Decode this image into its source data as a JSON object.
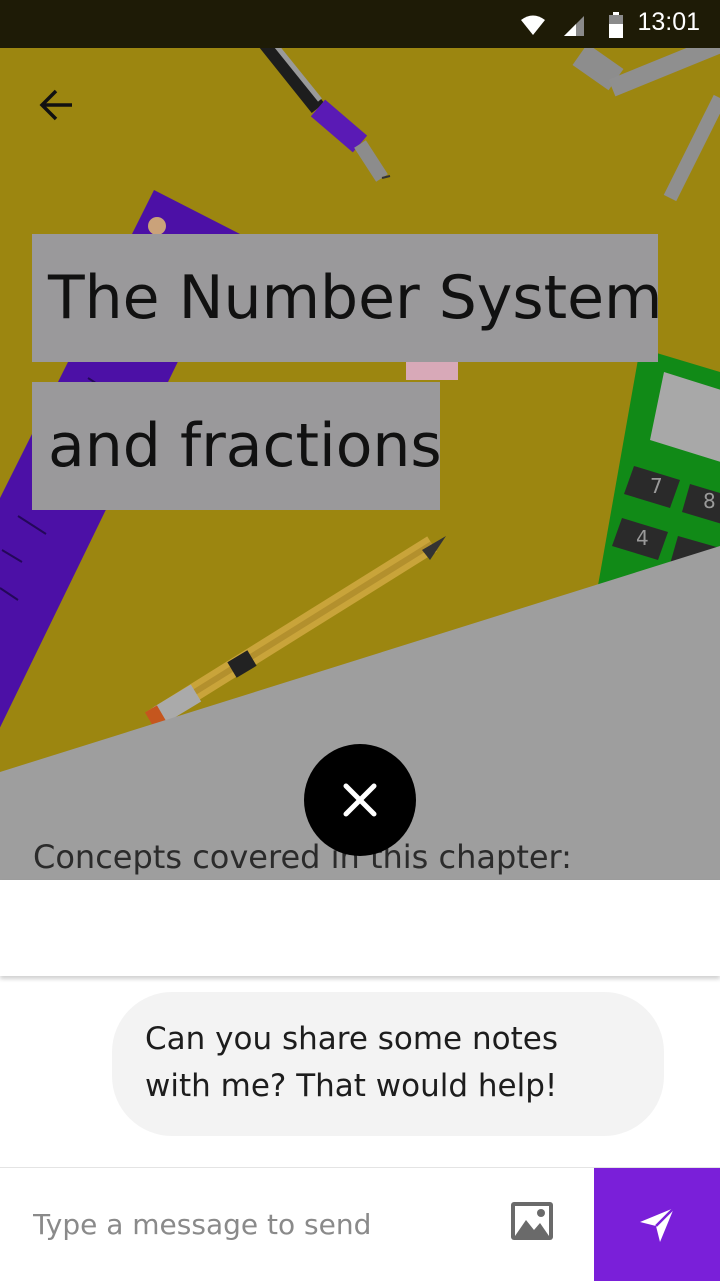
{
  "status_bar": {
    "time": "13:01",
    "icons": [
      "wifi-icon",
      "signal-icon",
      "battery-icon"
    ]
  },
  "header": {
    "back_icon": "arrow-left-icon"
  },
  "hero": {
    "title_line1": "The Number System",
    "title_line2": "and fractions",
    "concepts_label": "Concepts covered in this chapter:"
  },
  "overlay": {
    "close_icon": "close-icon"
  },
  "chat": {
    "message": "Can you share some notes with me? That would help!"
  },
  "composer": {
    "placeholder": "Type a message to send",
    "image_icon": "image-icon",
    "send_icon": "send-icon"
  },
  "colors": {
    "hero_background": "#9c8610",
    "title_background": "#9a999b",
    "send_button": "#7a1fd9",
    "bubble": "#f3f3f3"
  }
}
